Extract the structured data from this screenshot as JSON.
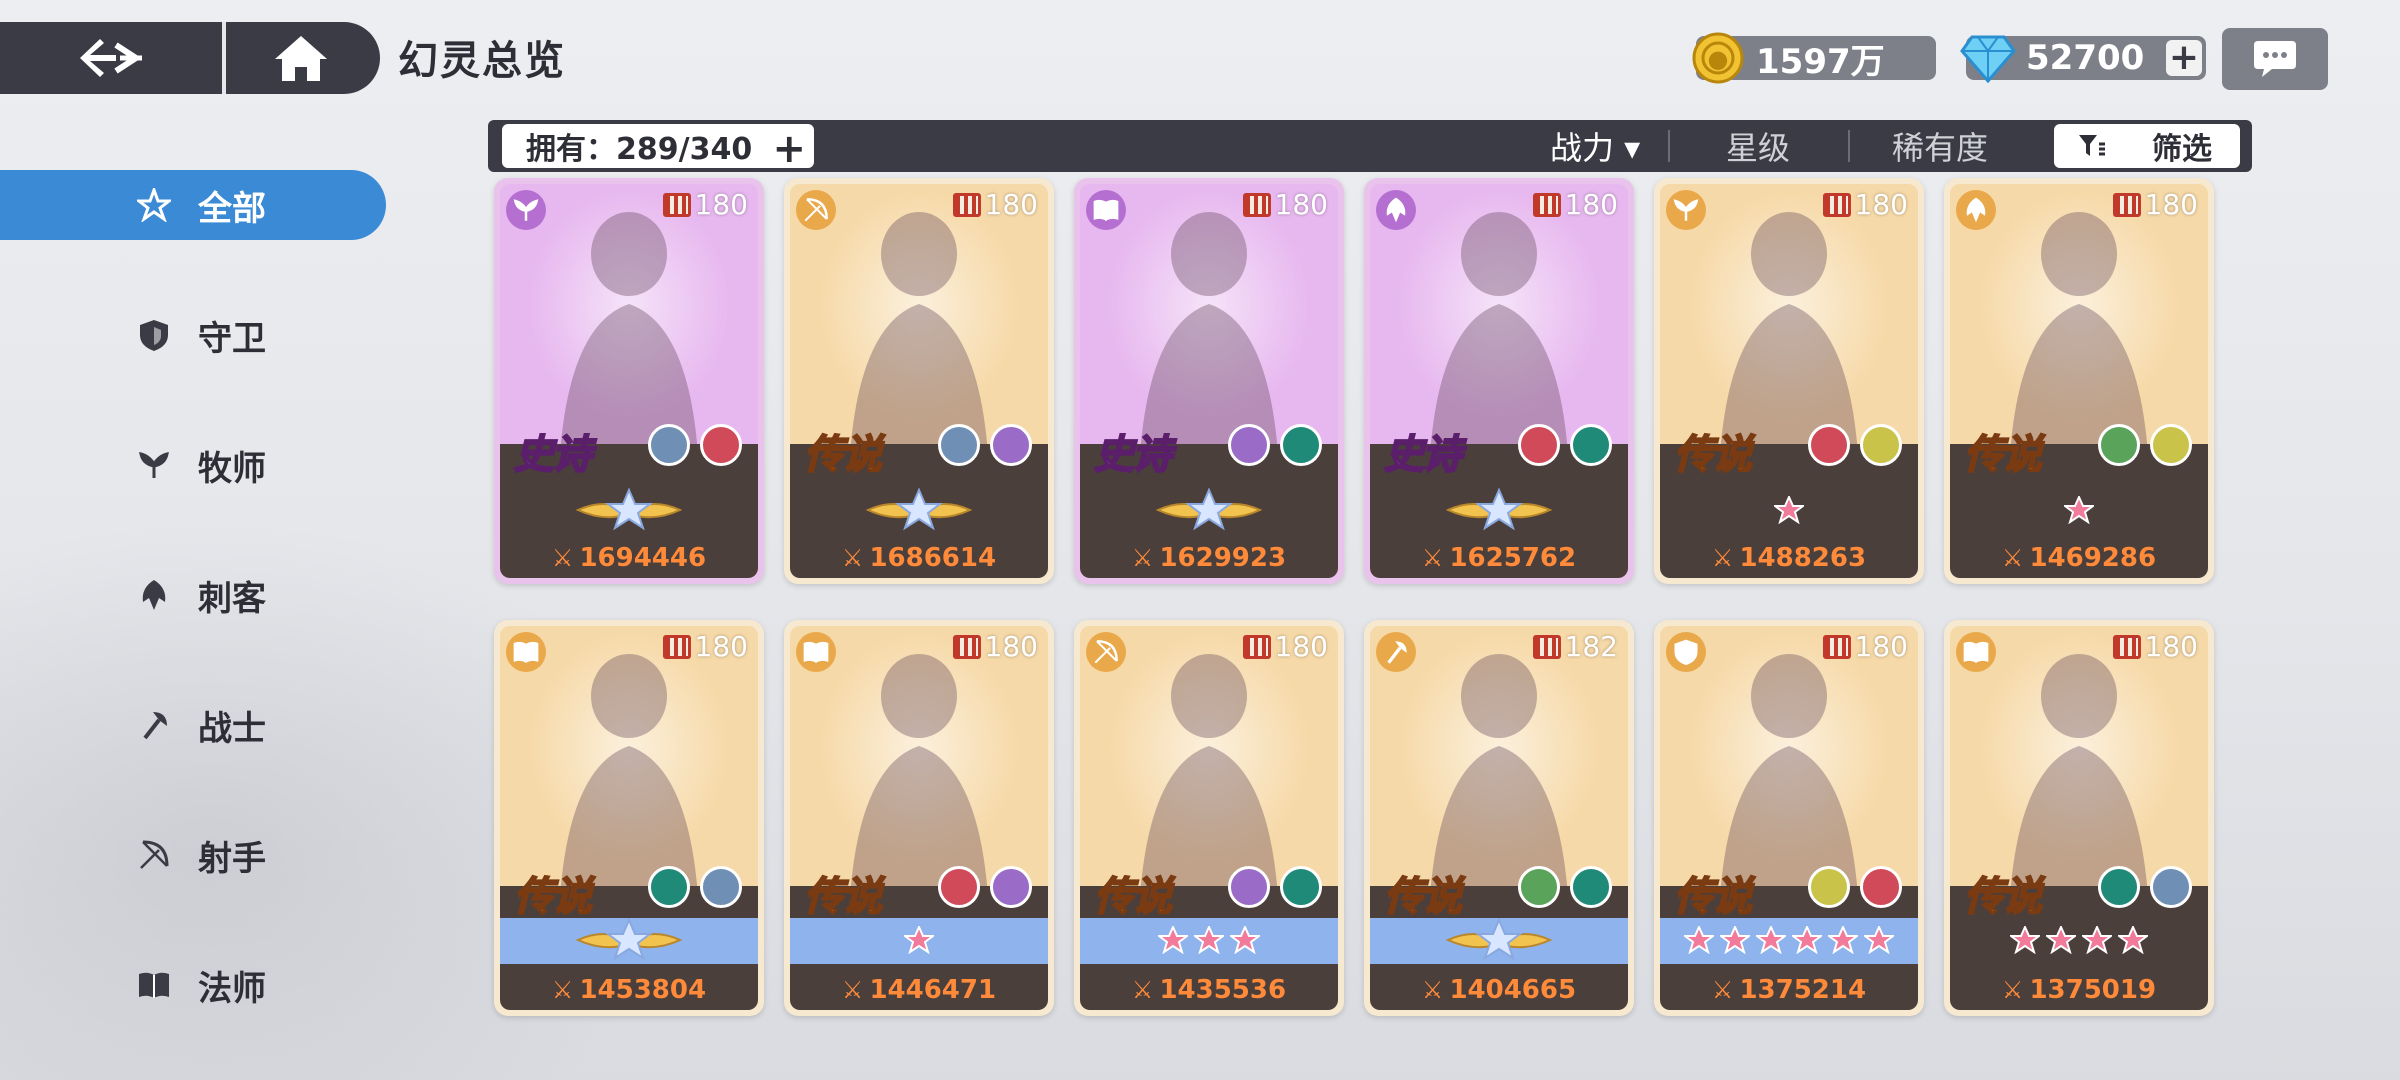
{
  "header": {
    "title": "幻灵总览",
    "back_icon": "back-arrow-icon",
    "home_icon": "home-icon"
  },
  "resources": {
    "gold": "1597万",
    "gems": "52700",
    "gem_plus": "+"
  },
  "filter_bar": {
    "owned_label": "拥有：289/340",
    "owned_plus": "+",
    "sort_power": "战力 ▾",
    "sort_star": "星级",
    "sort_rarity": "稀有度",
    "filter_label": "筛选"
  },
  "sidebar": {
    "items": [
      {
        "label": "全部",
        "icon": "all-star-icon"
      },
      {
        "label": "守卫",
        "icon": "shield-icon"
      },
      {
        "label": "牧师",
        "icon": "healer-icon"
      },
      {
        "label": "刺客",
        "icon": "assassin-icon"
      },
      {
        "label": "战士",
        "icon": "axe-icon"
      },
      {
        "label": "射手",
        "icon": "bow-icon"
      },
      {
        "label": "法师",
        "icon": "book-icon"
      }
    ]
  },
  "cards": [
    {
      "rarity": "史诗",
      "tier": "epic",
      "level": "180",
      "power": "1694446",
      "role": "healer-icon",
      "stars": "gold-crown",
      "bg": "#e7b8ef",
      "elements": [
        "#6f8fb5",
        "#d04a5a"
      ]
    },
    {
      "rarity": "传说",
      "tier": "legend",
      "level": "180",
      "power": "1686614",
      "role": "bow-icon",
      "stars": "gold-crown",
      "bg": "#f6d9a8",
      "elements": [
        "#6f8fb5",
        "#9a6bc7"
      ]
    },
    {
      "rarity": "史诗",
      "tier": "epic",
      "level": "180",
      "power": "1629923",
      "role": "book-icon",
      "stars": "gold-crown",
      "bg": "#e7b8ef",
      "elements": [
        "#9a6bc7",
        "#1f8a78"
      ]
    },
    {
      "rarity": "史诗",
      "tier": "epic",
      "level": "180",
      "power": "1625762",
      "role": "assassin-icon",
      "stars": "gold-crown",
      "bg": "#e7b8ef",
      "elements": [
        "#d04a5a",
        "#1f8a78"
      ]
    },
    {
      "rarity": "传说",
      "tier": "legend",
      "level": "180",
      "power": "1488263",
      "role": "healer-icon",
      "stars": "1",
      "bg": "#f6d9a8",
      "elements": [
        "#d04a5a",
        "#c9c34a"
      ]
    },
    {
      "rarity": "传说",
      "tier": "legend",
      "level": "180",
      "power": "1469286",
      "role": "assassin-icon",
      "stars": "1",
      "bg": "#f6d9a8",
      "elements": [
        "#5aa35a",
        "#c9c34a"
      ]
    },
    {
      "rarity": "传说",
      "tier": "legend",
      "level": "180",
      "power": "1453804",
      "role": "book-icon",
      "stars": "gold-crown",
      "bg": "#f6d9a8",
      "elements": [
        "#1f8a78",
        "#6f8fb5"
      ]
    },
    {
      "rarity": "传说",
      "tier": "legend",
      "level": "180",
      "power": "1446471",
      "role": "book-icon",
      "stars": "1",
      "bg": "#f6d9a8",
      "elements": [
        "#d04a5a",
        "#9a6bc7"
      ]
    },
    {
      "rarity": "传说",
      "tier": "legend",
      "level": "180",
      "power": "1435536",
      "role": "bow-icon",
      "stars": "3",
      "bg": "#f6d9a8",
      "elements": [
        "#9a6bc7",
        "#1f8a78"
      ]
    },
    {
      "rarity": "传说",
      "tier": "legend",
      "level": "182",
      "power": "1404665",
      "role": "axe-icon",
      "stars": "gold-crown",
      "bg": "#f6d9a8",
      "elements": [
        "#5aa35a",
        "#1f8a78"
      ]
    },
    {
      "rarity": "传说",
      "tier": "legend",
      "level": "180",
      "power": "1375214",
      "role": "shield-icon",
      "stars": "6",
      "bg": "#f6d9a8",
      "elements": [
        "#c9c34a",
        "#d04a5a"
      ]
    },
    {
      "rarity": "传说",
      "tier": "legend",
      "level": "180",
      "power": "1375019",
      "role": "book-icon",
      "stars": "4",
      "bg": "#f6d9a8",
      "elements": [
        "#1f8a78",
        "#6f8fb5"
      ]
    }
  ],
  "colors": {
    "accent": "#3a8ad6",
    "dark_panel": "#3a3b45",
    "power_text": "#ff8a3a",
    "star_pink": "#f27a9a"
  }
}
